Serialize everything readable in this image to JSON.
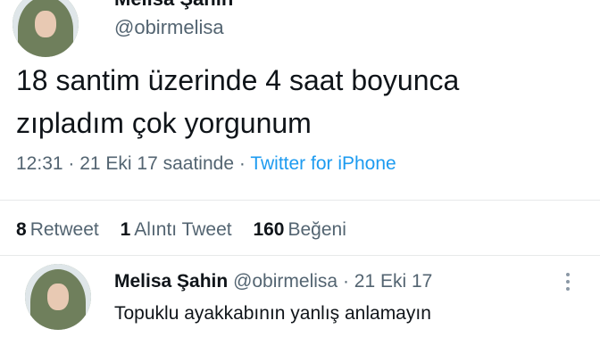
{
  "tweet": {
    "author_name": "Melisa Şahin",
    "author_handle": "@obirmelisa",
    "text_line1": "18 santim üzerinde 4 saat boyunca",
    "text_line2": "zıpladım çok yorgunum",
    "timestamp": "12:31 · 21 Eki 17 saatinde ·",
    "source": "Twitter for iPhone",
    "retweet_count": "8",
    "retweet_label": "Retweet",
    "quote_count": "1",
    "quote_label": "Alıntı Tweet",
    "like_count": "160",
    "like_label": "Beğeni"
  },
  "reply": {
    "author_name": "Melisa Şahin",
    "author_handle": "@obirmelisa",
    "date": "· 21 Eki 17",
    "text": "Topuklu ayakkabının yanlış anlamayın"
  },
  "icons": {
    "more": "more-vertical-icon"
  },
  "colors": {
    "secondary_text": "#536471",
    "link": "#1d9bf0",
    "text": "#0f1419"
  }
}
